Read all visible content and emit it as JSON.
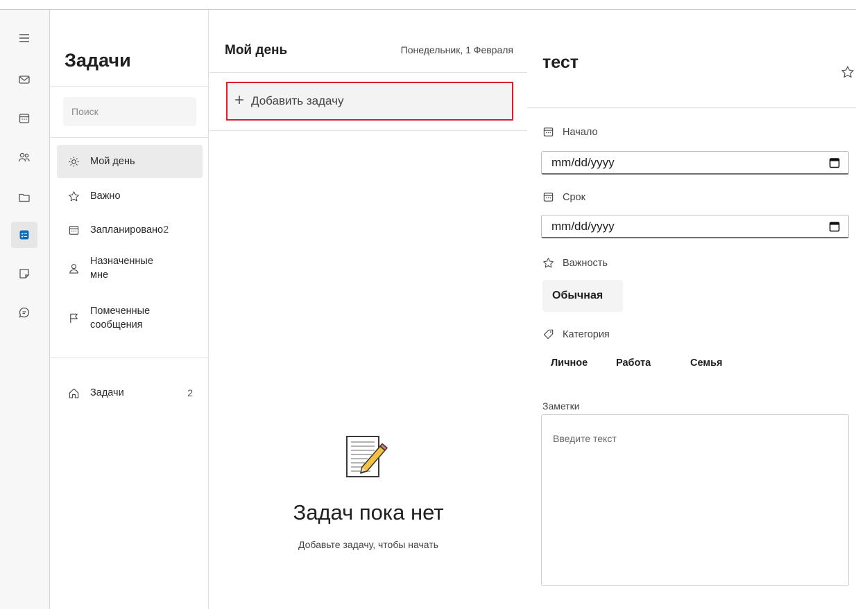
{
  "sidebar": {
    "title": "Задачи",
    "search_placeholder": "Поиск",
    "items": [
      {
        "label": "Мой день",
        "icon": "sun-icon",
        "active": true
      },
      {
        "label": "Важно",
        "icon": "star-icon"
      },
      {
        "label": "Запланировано",
        "count": "2",
        "icon": "calendar-icon"
      },
      {
        "label_line1": "Назначенные",
        "label_line2": "мне",
        "icon": "person-icon"
      },
      {
        "label_line1": "Помеченные",
        "label_line2": "сообщения",
        "icon": "flag-icon"
      }
    ],
    "lists": [
      {
        "label": "Задачи",
        "count": "2",
        "icon": "home-icon"
      }
    ]
  },
  "main": {
    "title": "Мой день",
    "date": "Понедельник, 1 Февраля",
    "add_task_icon": "+",
    "add_task_label": "Добавить задачу",
    "empty_title": "Задач пока нет",
    "empty_subtitle": "Добавьте задачу, чтобы начать"
  },
  "details": {
    "title": "тест",
    "start_label": "Начало",
    "start_value": "mm/dd/yyyy",
    "due_label": "Срок",
    "due_value": "mm/dd/yyyy",
    "importance_label": "Важность",
    "importance_value": "Обычная",
    "category_label": "Категория",
    "categories": [
      "Личное",
      "Работа",
      "Семья"
    ],
    "notes_label": "Заметки",
    "notes_placeholder": "Введите текст"
  },
  "colors": {
    "accent": "#0f6cbd",
    "highlight_border": "#d6202f"
  }
}
